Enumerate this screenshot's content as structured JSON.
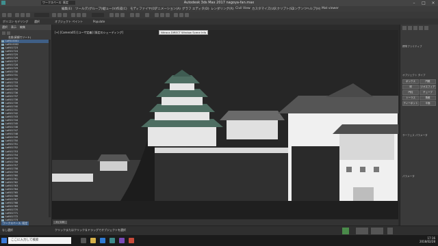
{
  "window": {
    "title": "Autodesk 3ds Max 2017    nagoya-fan.max",
    "workspace": "ワークスペース: 既定"
  },
  "menus": [
    "編集(E)",
    "ツール(T)",
    "グループ(G)",
    "ビュー(V)",
    "作成(C)",
    "モディファイヤ(O)",
    "アニメーション(A)",
    "グラフ エディタ(D)",
    "レンダリング(R)",
    "Civil View",
    "カスタマイズ(U)",
    "スクリプト(S)",
    "コンテンツ",
    "ヘルプ(H)",
    "Mat viewer"
  ],
  "ribbon": {
    "tabs": [
      "ポリゴン モデリング",
      "選択",
      "オブジェクト ペイント",
      "Populate"
    ]
  },
  "explorer": {
    "tabs": [
      "選択",
      "表示",
      "編集"
    ],
    "header": "名前(昇順でソート)",
    "rows": [
      "Loft0.0001",
      "Loft0.0002",
      "Loft01723",
      "Loft01724",
      "Loft01725",
      "Loft01726",
      "Loft01727",
      "Loft01728",
      "Loft01729",
      "Loft01730",
      "Loft01731",
      "Loft01732",
      "Loft01733",
      "Loft01734",
      "Loft01735",
      "Loft01736",
      "Loft01737",
      "Loft01738",
      "Loft01739",
      "Loft01740",
      "Loft01741",
      "Loft01742",
      "Loft01743",
      "Loft01744",
      "Loft01745",
      "Loft01746",
      "Loft01747",
      "Loft01748",
      "Loft01749",
      "Loft01750",
      "Loft01751",
      "Loft01752",
      "Loft01753",
      "Loft01754",
      "Loft01755",
      "Loft01756",
      "Loft01757",
      "Loft01758",
      "Loft01759",
      "Loft01760",
      "Loft01761",
      "Loft01762",
      "Loft01763",
      "Loft01764",
      "Loft01765",
      "Loft01766",
      "Loft01767",
      "Loft01768",
      "Loft01769",
      "Loft01770",
      "Loft01771",
      "Loft01772",
      "Loft01773"
    ],
    "footer": "ワークスペース: 既定"
  },
  "viewport": {
    "label": "[+] [Camera05] [ユーザ定義] [既定のシェーディング]",
    "tooltip": "Nitrous DIRECT Window Scene Info"
  },
  "command_panel": {
    "sections": [
      "標準プリミティブ",
      "オブジェクト タイプ",
      "サーフェス パラメータ",
      "パラメータ"
    ],
    "buttons": [
      "ボックス",
      "円錐",
      "球",
      "ジオスフィア",
      "円柱",
      "チューブ",
      "トーラス",
      "角錐",
      "ティーポット",
      "平面"
    ]
  },
  "timeline": {
    "frame": "0 / 100"
  },
  "status": {
    "selected": "なし選択",
    "hint": "クリックまたはクリック＆ドラッグでオブジェクトを選択"
  },
  "taskbar": {
    "search_placeholder": "ここに入力して検索",
    "time": "17:16",
    "date": "2018/02/28"
  },
  "colors": {
    "viewport_bg": "#262626",
    "selection": "#3f5f86",
    "roof_green": "#4e6e62"
  }
}
